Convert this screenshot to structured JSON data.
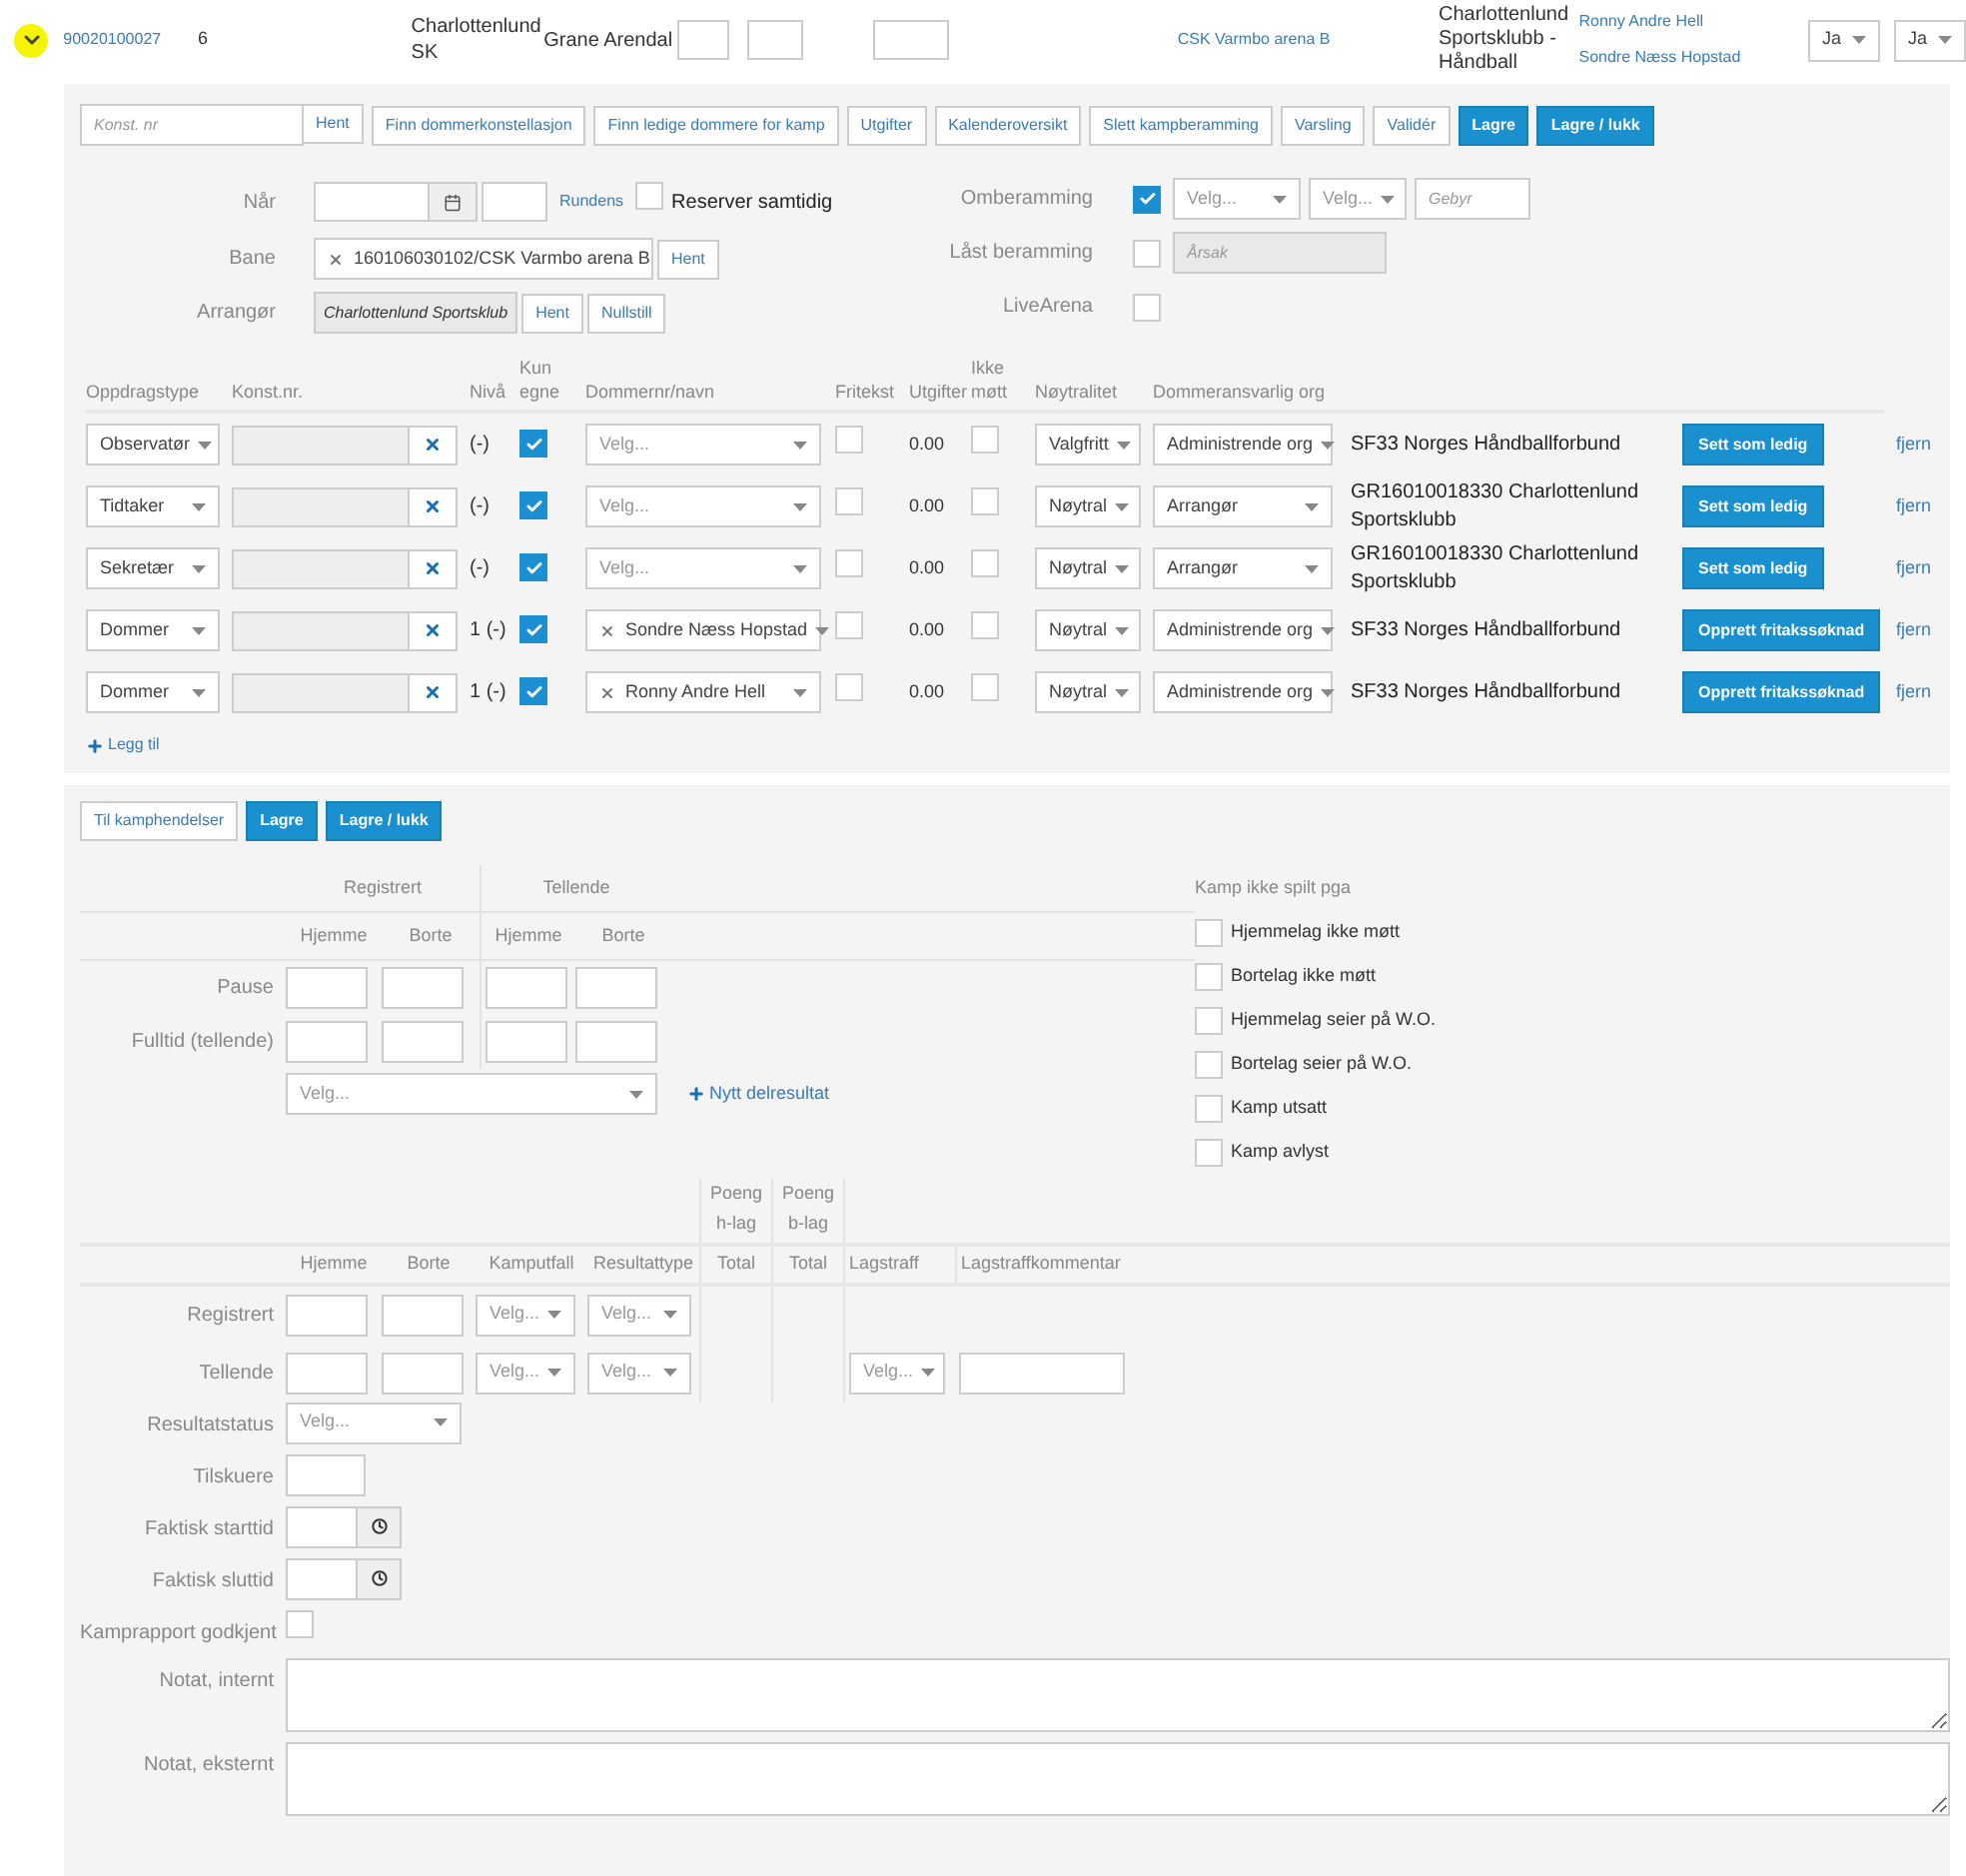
{
  "match": {
    "expanded": true,
    "number": "90020100027",
    "round": "6",
    "home_team": "Charlottenlund SK",
    "away_team": "Grane Arendal",
    "venue": "CSK Varmbo arena B",
    "organizer": "Charlottenlund Sportsklubb - Håndball",
    "referees": [
      "Ronny Andre Hell",
      "Sondre Næss Hopstad"
    ],
    "selects": [
      "Ja",
      "Ja"
    ]
  },
  "toolbar": {
    "search": {
      "placeholder": "Konst. nr",
      "button": "Hent"
    },
    "buttons": [
      {
        "label": "Finn dommerkonstellasjon",
        "kind": "default"
      },
      {
        "label": "Finn ledige dommere for kamp",
        "kind": "default"
      },
      {
        "label": "Utgifter",
        "kind": "default"
      },
      {
        "label": "Kalenderoversikt",
        "kind": "default"
      },
      {
        "label": "Slett kampberamming",
        "kind": "default"
      },
      {
        "label": "Varsling",
        "kind": "default"
      },
      {
        "label": "Validér",
        "kind": "default"
      },
      {
        "label": "Lagre",
        "kind": "primary"
      },
      {
        "label": "Lagre / lukk",
        "kind": "primary"
      }
    ]
  },
  "scheduling": {
    "when": {
      "label": "Når",
      "round_link": "Rundens",
      "reserve": {
        "label": "Reserver samtidig",
        "checked": false
      }
    },
    "venue": {
      "label": "Bane",
      "value": "160106030102/CSK Varmbo arena B",
      "button": "Hent"
    },
    "organizer": {
      "label": "Arrangør",
      "value": "Charlottenlund Sportsklub",
      "buttons": [
        "Hent",
        "Nullstill"
      ]
    },
    "rescheduling": {
      "label": "Omberamming",
      "checked": true,
      "selects": [
        "Velg...",
        "Velg..."
      ],
      "fee_placeholder": "Gebyr"
    },
    "locked": {
      "label": "Låst beramming",
      "checked": false,
      "reason_placeholder": "Årsak"
    },
    "live_arena": {
      "label": "LiveArena",
      "checked": false
    }
  },
  "assignments": {
    "columns": [
      "Oppdragstype",
      "Konst.nr.",
      "Nivå",
      "Kun egne",
      "Dommernr/navn",
      "Fritekst",
      "Utgifter",
      "Ikke møtt",
      "Nøytralitet",
      "Dommeransvarlig org"
    ],
    "rows": [
      {
        "type": "Observatør",
        "level": "(-)",
        "own_only": true,
        "referee": {
          "placeholder": "Velg..."
        },
        "free_text": false,
        "expenses": "0.00",
        "absent": false,
        "neutrality": "Valgfritt",
        "responsible": "Administrende org",
        "org": "SF33 Norges Håndballforbund",
        "action": "Sett som ledig",
        "remove": "fjern"
      },
      {
        "type": "Tidtaker",
        "level": "(-)",
        "own_only": true,
        "referee": {
          "placeholder": "Velg..."
        },
        "free_text": false,
        "expenses": "0.00",
        "absent": false,
        "neutrality": "Nøytral",
        "responsible": "Arrangør",
        "org": "GR16010018330 Charlottenlund Sportsklubb",
        "action": "Sett som ledig",
        "remove": "fjern"
      },
      {
        "type": "Sekretær",
        "level": "(-)",
        "own_only": true,
        "referee": {
          "placeholder": "Velg..."
        },
        "free_text": false,
        "expenses": "0.00",
        "absent": false,
        "neutrality": "Nøytral",
        "responsible": "Arrangør",
        "org": "GR16010018330 Charlottenlund Sportsklubb",
        "action": "Sett som ledig",
        "remove": "fjern"
      },
      {
        "type": "Dommer",
        "level": "1 (-)",
        "own_only": true,
        "referee": {
          "value": "Sondre Næss Hopstad"
        },
        "free_text": false,
        "expenses": "0.00",
        "absent": false,
        "neutrality": "Nøytral",
        "responsible": "Administrende org",
        "org": "SF33 Norges Håndballforbund",
        "action": "Opprett fritakssøknad",
        "remove": "fjern"
      },
      {
        "type": "Dommer",
        "level": "1 (-)",
        "own_only": true,
        "referee": {
          "value": "Ronny Andre Hell"
        },
        "free_text": false,
        "expenses": "0.00",
        "absent": false,
        "neutrality": "Nøytral",
        "responsible": "Administrende org",
        "org": "SF33 Norges Håndballforbund",
        "action": "Opprett fritakssøknad",
        "remove": "fjern"
      }
    ],
    "add_link": "Legg til"
  },
  "results": {
    "buttons": [
      {
        "label": "Til kamphendelser",
        "kind": "default"
      },
      {
        "label": "Lagre",
        "kind": "primary"
      },
      {
        "label": "Lagre / lukk",
        "kind": "primary"
      }
    ],
    "partial": {
      "groups": [
        "Registrert",
        "Tellende"
      ],
      "columns": [
        "Hjemme",
        "Borte",
        "Hjemme",
        "Borte"
      ],
      "rows": [
        "Pause",
        "Fulltid (tellende)"
      ],
      "select_placeholder": "Velg...",
      "add_link": "Nytt delresultat"
    },
    "not_played": {
      "title": "Kamp ikke spilt pga",
      "options": [
        {
          "label": "Hjemmelag ikke møtt",
          "checked": false
        },
        {
          "label": "Bortelag ikke møtt",
          "checked": false
        },
        {
          "label": "Hjemmelag seier på W.O.",
          "checked": false
        },
        {
          "label": "Bortelag seier på W.O.",
          "checked": false
        },
        {
          "label": "Kamp utsatt",
          "checked": false
        },
        {
          "label": "Kamp avlyst",
          "checked": false
        }
      ]
    },
    "final": {
      "group_headers": [
        "Poeng h-lag",
        "Poeng b-lag"
      ],
      "columns": [
        "Hjemme",
        "Borte",
        "Kamputfall",
        "Resultattype",
        "Total",
        "Total",
        "Lagstraff",
        "Lagstraffkommentar"
      ],
      "rows": [
        {
          "label": "Registrert",
          "selects": [
            "Velg...",
            "Velg..."
          ]
        },
        {
          "label": "Tellende",
          "selects": [
            "Velg...",
            "Velg..."
          ],
          "penalty_select": "Velg..."
        }
      ]
    },
    "fields": [
      {
        "label": "Resultatstatus",
        "kind": "select",
        "placeholder": "Velg..."
      },
      {
        "label": "Tilskuere",
        "kind": "input"
      },
      {
        "label": "Faktisk starttid",
        "kind": "time"
      },
      {
        "label": "Faktisk sluttid",
        "kind": "time"
      },
      {
        "label": "Kamprapport godkjent",
        "kind": "checkbox",
        "checked": false
      },
      {
        "label": "Notat, internt",
        "kind": "textarea"
      },
      {
        "label": "Notat, eksternt",
        "kind": "textarea"
      }
    ]
  }
}
